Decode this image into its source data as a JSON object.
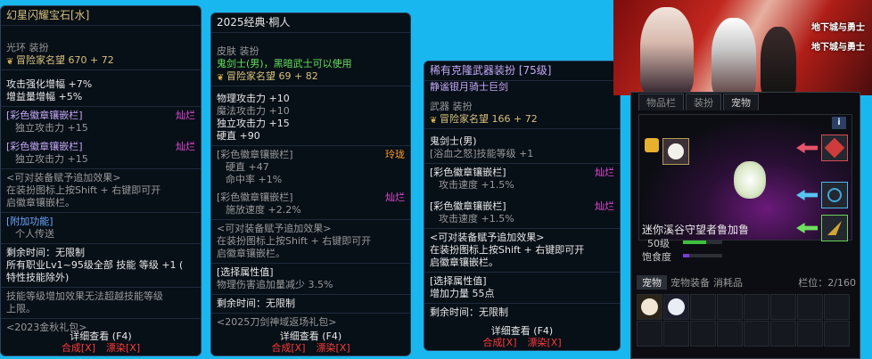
{
  "tooltip1": {
    "title": "幻星闪耀宝石[水]",
    "type": "光环 装扮",
    "adv": "冒险家名望 670 + 72",
    "stat1": "攻击强化增幅 +7%",
    "stat2": "增益量增幅 +5%",
    "slot1_name": "[彩色徽章镶嵌栏]",
    "slot1_tag": "灿烂",
    "slot1_val": "独立攻击力 +15",
    "slot2_name": "[彩色徽章镶嵌栏]",
    "slot2_tag": "灿烂",
    "slot2_val": "独立攻击力 +15",
    "grant1": "<可对装备赋予追加效果>",
    "grant2": "在装扮图标上按Shift + 右键即可开",
    "grant3": "启徽章镶嵌栏。",
    "extra_h": "[附加功能]",
    "extra_v": "个人传送",
    "time": "剩余时间：无限制",
    "skill1": "所有职业Lv1~95级全部 技能 等级 +1 (",
    "skill2": "特性技能除外)",
    "note1": "技能等级增加效果无法超越技能等级",
    "note2": "上限。",
    "source": "<2023金秋礼包>",
    "detail": "详细查看 (F4)",
    "btn_combine": "合成[X]",
    "btn_dye": "漂染[X]"
  },
  "tooltip2": {
    "title": "2025经典·桐人",
    "type": "皮肤 装扮",
    "class": "鬼剑士(男)，黑暗武士可以使用",
    "adv": "冒险家名望 69 + 82",
    "stat1": "物理攻击力 +10",
    "stat2": "魔法攻击力 +10",
    "stat3": "独立攻击力 +15",
    "stat4": "硬直 +90",
    "slot1_name": "[彩色徽章镶嵌栏]",
    "slot1_tag": "玲珑",
    "slot1_val1": "硬直 +47",
    "slot1_val2": "命中率 +1%",
    "slot2_name": "[彩色徽章镶嵌栏]",
    "slot2_tag": "灿烂",
    "slot2_val": "施放速度 +2.2%",
    "grant1": "<可对装备赋予追加效果>",
    "grant2": "在装扮图标上按Shift + 右键即可开",
    "grant3": "启徽章镶嵌栏。",
    "sel_h": "[选择属性值]",
    "sel_v": "物理伤害追加量减少 3.5%",
    "time": "剩余时间：无限制",
    "source": "<2025刀剑神域返场礼包>",
    "detail": "详细查看 (F4)",
    "btn_combine": "合成[X]",
    "btn_dye": "漂染[X]"
  },
  "tooltip3": {
    "title": "稀有克隆武器装扮 [75级]",
    "name": "静谧银月骑士巨剑",
    "type": "武器 装扮",
    "adv": "冒险家名望 166 + 72",
    "class": "鬼剑士(男)",
    "bonus": "[浴血之怒]技能等级 +1",
    "slot1_name": "[彩色徽章镶嵌栏]",
    "slot1_tag": "灿烂",
    "slot1_val": "攻击速度 +1.5%",
    "slot2_name": "[彩色徽章镶嵌栏]",
    "slot2_tag": "灿烂",
    "slot2_val": "攻击速度 +1.5%",
    "grant1": "<可对装备赋予追加效果>",
    "grant2": "在装扮图标上按Shift + 右键即可开",
    "grant3": "启徽章镶嵌栏。",
    "sel_h": "[选择属性值]",
    "sel_v": "增加力量 55点",
    "time": "剩余时间：无限制",
    "detail": "详细查看 (F4)",
    "btn_combine": "合成[X]",
    "btn_dye": "漂染[X]"
  },
  "banner": {
    "logo1": "地下城与勇士",
    "logo2": "地下城与勇士"
  },
  "pet": {
    "tab1": "物品栏",
    "tab2": "装扮",
    "tab3": "宠物",
    "info": "i",
    "pet_name": "迷你溪谷守望者鲁加鲁",
    "level": "50级",
    "satiety": "饱食度",
    "btab1": "宠物",
    "btab2": "宠物装备",
    "btab3": "消耗品",
    "slots": "栏位：2/160"
  },
  "colors": {
    "accent_red": "#ff3a38",
    "accent_purple": "#c5a8f5",
    "background": "#19b7ef"
  }
}
